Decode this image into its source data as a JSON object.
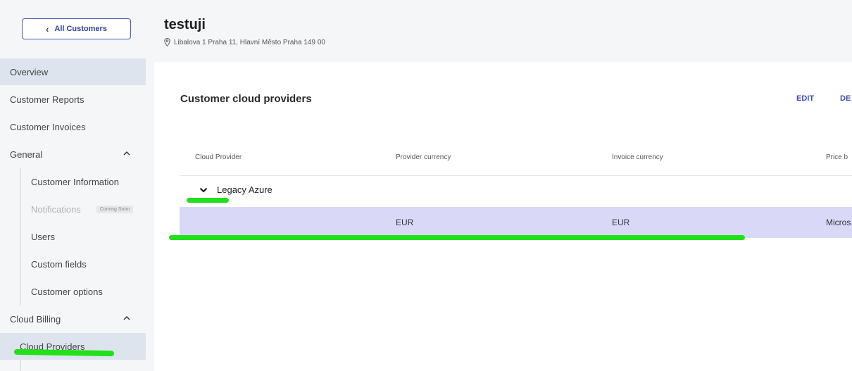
{
  "header": {
    "back_label": "All Customers",
    "customer_name": "testuji",
    "address": "Libalova 1 Praha 11, Hlavní Město Praha 149 00"
  },
  "sidebar": {
    "items": [
      {
        "label": "Overview"
      },
      {
        "label": "Customer Reports"
      },
      {
        "label": "Customer Invoices"
      },
      {
        "label": "General"
      },
      {
        "label": "Customer Information"
      },
      {
        "label": "Notifications",
        "badge": "Coming Soon"
      },
      {
        "label": "Users"
      },
      {
        "label": "Custom fields"
      },
      {
        "label": "Customer options"
      },
      {
        "label": "Cloud Billing"
      },
      {
        "label": "Cloud Providers"
      }
    ]
  },
  "main": {
    "title": "Customer cloud providers",
    "edit_label": "EDIT",
    "delete_label": "DE",
    "columns": [
      "Cloud Provider",
      "Provider currency",
      "Invoice currency",
      "Price b"
    ],
    "group": {
      "label": "Legacy Azure"
    },
    "rows": [
      {
        "cells": [
          "",
          "EUR",
          "EUR",
          "Micros"
        ]
      }
    ]
  },
  "colors": {
    "accent": "#3a4bb5",
    "active_nav": "#dde4ee",
    "selected_row": "#d9d9f7",
    "highlighter": "#22e01a"
  }
}
